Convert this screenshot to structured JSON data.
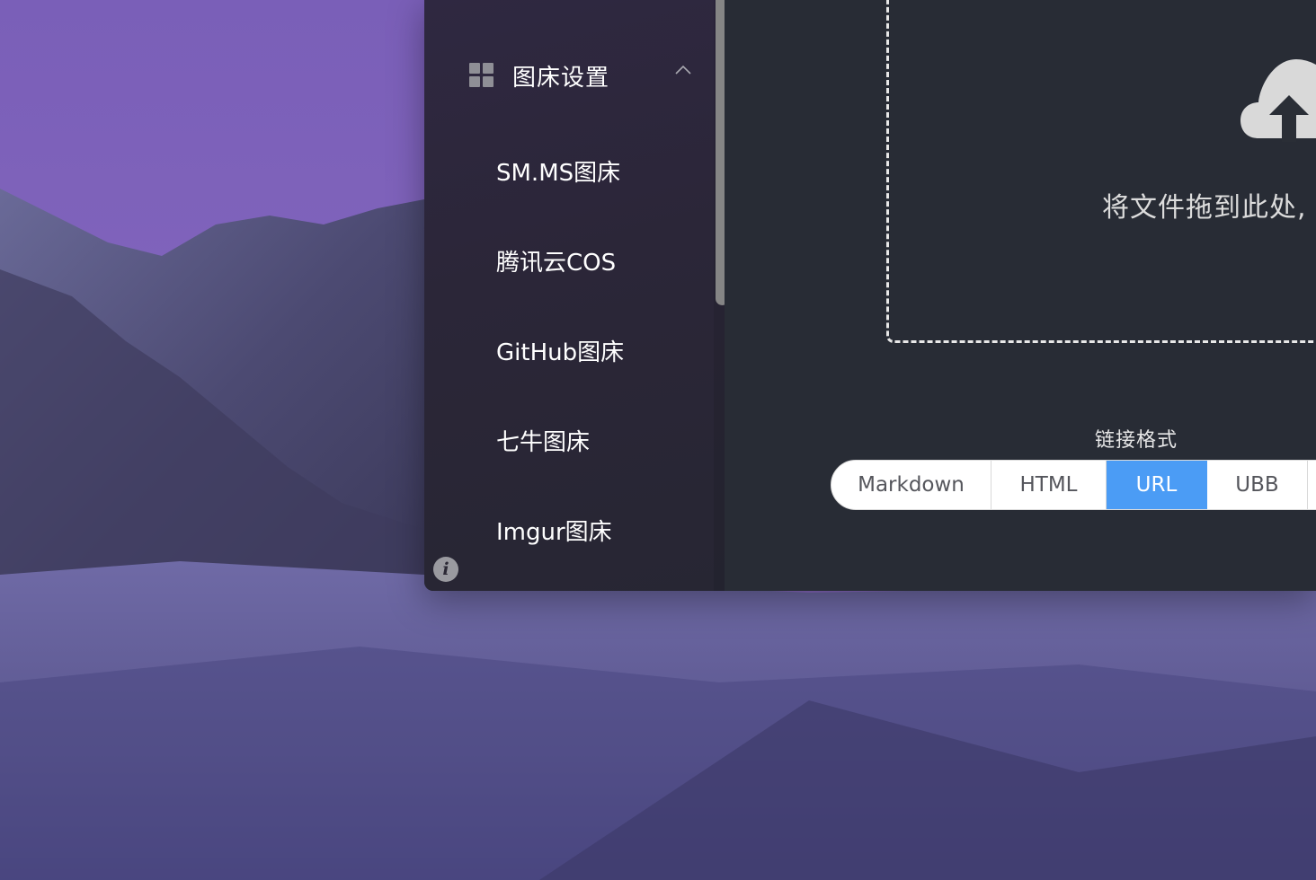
{
  "sidebar": {
    "section_title": "图床设置",
    "items": [
      {
        "label": "SM.MS图床"
      },
      {
        "label": "腾讯云COS"
      },
      {
        "label": "GitHub图床"
      },
      {
        "label": "七牛图床"
      },
      {
        "label": "Imgur图床"
      }
    ],
    "info_label": "i"
  },
  "upload": {
    "drop_text": "将文件拖到此处,"
  },
  "link_format": {
    "title": "链接格式",
    "options": [
      {
        "label": "Markdown",
        "selected": false
      },
      {
        "label": "HTML",
        "selected": false
      },
      {
        "label": "URL",
        "selected": true
      },
      {
        "label": "UBB",
        "selected": false
      }
    ]
  },
  "icons": {
    "section": "grid-icon",
    "collapse": "chevron-up-icon",
    "upload": "cloud-upload-icon",
    "info": "info-icon"
  },
  "colors": {
    "accent": "#4b9cf5",
    "sidebar_bg": "#2b2638",
    "main_bg": "#282c35",
    "text": "#ffffff"
  }
}
